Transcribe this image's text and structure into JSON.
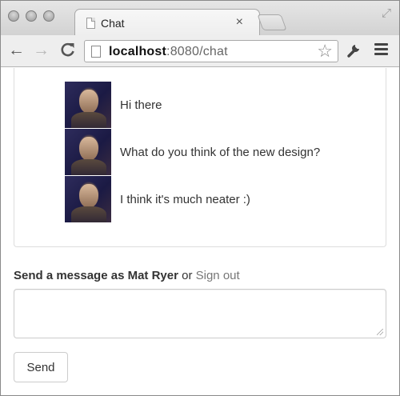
{
  "browser": {
    "tab": {
      "title": "Chat",
      "close": "×"
    },
    "toolbar": {
      "url_host": "localhost",
      "url_rest": ":8080/chat"
    },
    "icons": {
      "back": "←",
      "forward": "→",
      "reload": "C",
      "star": "☆",
      "wrench": "🔧",
      "fullscreen": "⤢"
    }
  },
  "chat": {
    "messages": [
      {
        "text": "Hi there"
      },
      {
        "text": "What do you think of the new design?"
      },
      {
        "text": "I think it's much neater :)"
      }
    ],
    "compose": {
      "prefix": "Send a message as Mat Ryer",
      "connector": " or ",
      "signout_label": "Sign out",
      "input_value": "",
      "send_label": "Send"
    }
  }
}
